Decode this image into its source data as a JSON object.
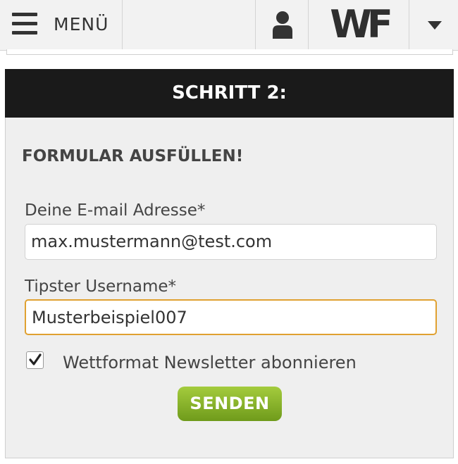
{
  "header": {
    "menu_label": "MENÜ",
    "logo_text": "WF",
    "icons": [
      "hamburger-icon",
      "user-icon",
      "caret-down-icon"
    ]
  },
  "panel": {
    "title": "SCHRITT 2:",
    "heading": "FORMULAR AUSFÜLLEN!"
  },
  "form": {
    "email_label": "Deine E-mail Adresse*",
    "email_value": "max.mustermann@test.com",
    "username_label": "Tipster Username*",
    "username_value": "Musterbeispiel007",
    "newsletter_label": "Wettformat Newsletter abonnieren",
    "newsletter_checked": true,
    "submit_label": "SENDEN"
  },
  "colors": {
    "title_bar": "#1a1a1a",
    "focus_border": "#e0a131",
    "button_green": "#8cb82c",
    "panel_bg": "#efefef"
  }
}
